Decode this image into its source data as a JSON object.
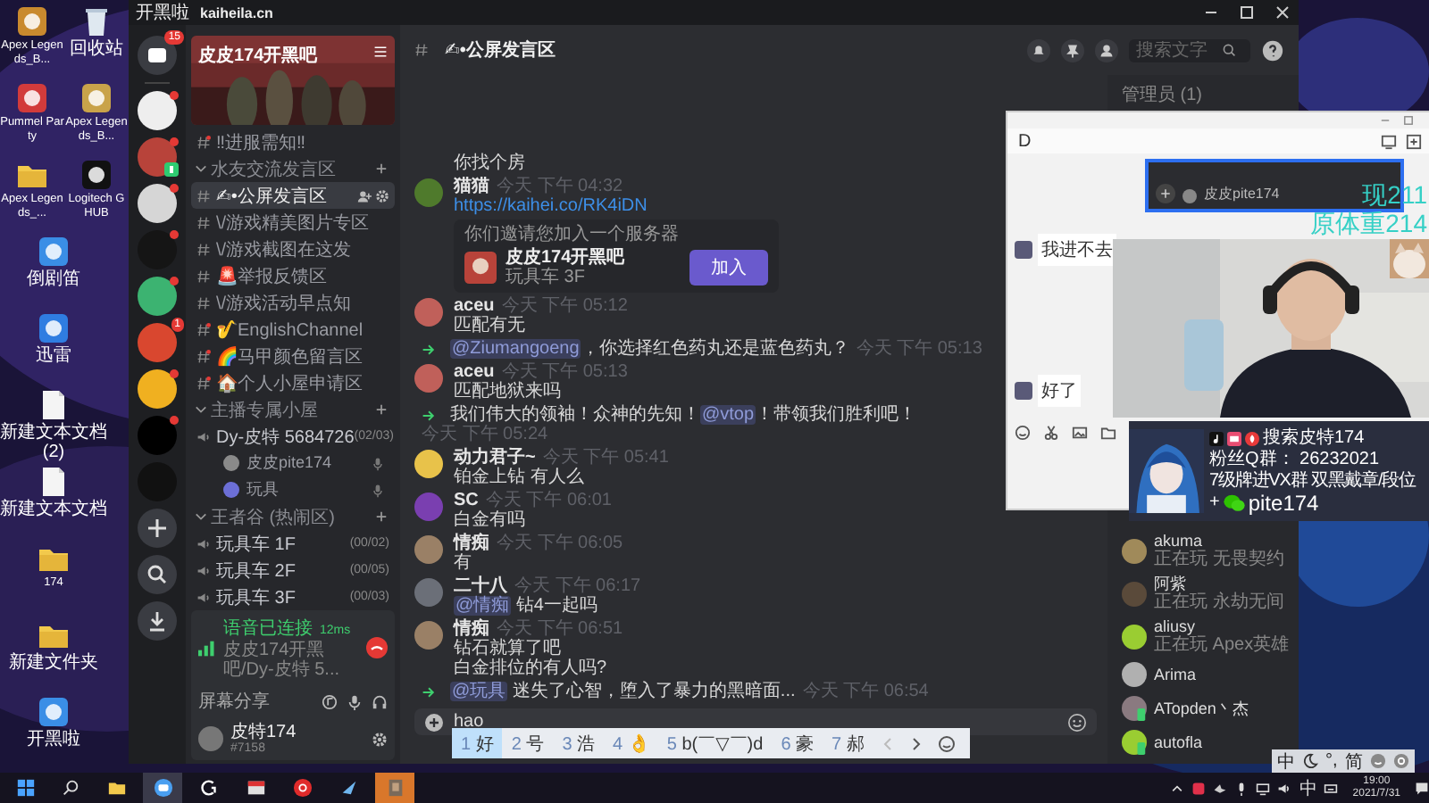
{
  "desktop_icons": [
    {
      "kind": "app",
      "color": "#c98a2e",
      "label": "Apex Legends_B..."
    },
    {
      "kind": "bin",
      "label": "回收站"
    },
    {
      "kind": "app",
      "color": "#d23b3b",
      "label": "Pummel Party"
    },
    {
      "kind": "app",
      "color": "#c9a34a",
      "label": "Apex Legends_B..."
    },
    {
      "kind": "folder",
      "label": "Apex Legends_..."
    },
    {
      "kind": "app",
      "color": "#111111",
      "label": "Logitech G HUB"
    },
    {
      "kind": "app",
      "color": "#3a8ee6",
      "label": "倒剧笛"
    },
    {
      "kind": "app",
      "color": "#2f7de1",
      "label": "迅雷"
    },
    {
      "kind": "file",
      "label": "新建文本文档 (2)"
    },
    {
      "kind": "file",
      "label": "新建文本文档"
    },
    {
      "kind": "folder",
      "label": "174"
    },
    {
      "kind": "folder",
      "label": "新建文件夹"
    },
    {
      "kind": "app",
      "color": "#3a8ee6",
      "label": "开黑啦"
    }
  ],
  "app": {
    "title": "开黑啦",
    "url": "kaiheila.cn",
    "home_badge": "15",
    "servers": [
      {
        "color": "#eeeeee",
        "unread": true,
        "in_voice": false
      },
      {
        "color": "#b8433a",
        "unread": true,
        "in_voice": true
      },
      {
        "color": "#d6d6d6",
        "unread": true,
        "in_voice": false
      },
      {
        "color": "#151515",
        "unread": true,
        "in_voice": false
      },
      {
        "color": "#3cb371",
        "unread": true,
        "in_voice": false
      },
      {
        "color": "#d9472f",
        "unread": false,
        "badge": "1",
        "in_voice": false
      },
      {
        "color": "#f0b020",
        "unread": true,
        "in_voice": false
      },
      {
        "color": "#000000",
        "unread": true,
        "in_voice": false
      },
      {
        "color": "#111111",
        "unread": false,
        "in_voice": false
      }
    ],
    "server_name": "皮皮174开黑吧",
    "channels": [
      {
        "kind": "text",
        "name": "‼进服需知‼",
        "unread": true,
        "selected": false
      },
      {
        "kind": "category",
        "name": "水友交流发言区",
        "children": [
          {
            "kind": "text",
            "name": "✍•公屏发言区",
            "unread": false,
            "selected": true
          },
          {
            "kind": "text",
            "name": "\\/游戏精美图片专区",
            "unread": false,
            "selected": false
          },
          {
            "kind": "text",
            "name": "\\/游戏截图在这发",
            "unread": false,
            "selected": false
          },
          {
            "kind": "text",
            "name": "🚨举报反馈区",
            "unread": false,
            "selected": false
          },
          {
            "kind": "text",
            "name": "\\/游戏活动早点知",
            "unread": false,
            "selected": false
          },
          {
            "kind": "text",
            "name": "🎷EnglishChannel",
            "unread": true,
            "selected": false
          },
          {
            "kind": "text",
            "name": "🌈马甲颜色留言区",
            "unread": true,
            "selected": false
          },
          {
            "kind": "text",
            "name": "🏠个人小屋申请区",
            "unread": true,
            "selected": false
          }
        ]
      },
      {
        "kind": "category",
        "name": "主播专属小屋",
        "children": [
          {
            "kind": "voice",
            "name": "Dy-皮特 5684726",
            "count": "(02/03)",
            "children": [
              {
                "name": "皮皮pite174",
                "color": "#8a8a8a"
              },
              {
                "name": "玩具",
                "color": "#6c6fd6"
              }
            ]
          }
        ]
      },
      {
        "kind": "category",
        "name": "王者谷 (热闹区)",
        "children": [
          {
            "kind": "voice",
            "name": "玩具车 1F",
            "count": "(00/02)"
          },
          {
            "kind": "voice",
            "name": "玩具车 2F",
            "count": "(00/05)"
          },
          {
            "kind": "voice",
            "name": "玩具车 3F",
            "count": "(00/03)"
          }
        ]
      }
    ],
    "voice_status": {
      "state": "语音已连接",
      "ping": "12ms",
      "channel": "皮皮174开黑吧/Dy-皮特 5..."
    },
    "share_label": "屏幕分享",
    "user": {
      "name": "皮特174",
      "tag": "#7158"
    },
    "chat": {
      "channel": "✍•公屏发言区",
      "search_placeholder": "搜索文字",
      "messages": [
        {
          "kind": "continuation",
          "lines": [
            {
              "text": "你找个房"
            }
          ]
        },
        {
          "kind": "message",
          "author": "猫猫",
          "time": "今天 下午 04:32",
          "color": "#4f7a2c",
          "link": "https://kaihei.co/RK4iDN",
          "invite": {
            "caption": "你们邀请您加入一个服务器",
            "name": "皮皮174开黑吧",
            "channel": "玩具车 3F",
            "button": "加入"
          }
        },
        {
          "kind": "message",
          "author": "aceu",
          "time": "今天 下午 05:12",
          "color": "#c0605a",
          "lines": [
            {
              "text": "匹配有无"
            }
          ]
        },
        {
          "kind": "system",
          "time": "今天 下午 05:13",
          "lines": [
            {
              "mention": "@Ziumangoeng",
              "text": "，你选择红色药丸还是蓝色药丸？"
            }
          ]
        },
        {
          "kind": "message",
          "author": "aceu",
          "time": "今天 下午 05:13",
          "color": "#c0605a",
          "lines": [
            {
              "text": "匹配地狱来吗"
            }
          ]
        },
        {
          "kind": "system",
          "time": "今天 下午 05:24",
          "lines": [
            {
              "before": "我们伟大的领袖！众神的先知！",
              "mention": "@vtop",
              "text": "！带领我们胜利吧！"
            }
          ]
        },
        {
          "kind": "message",
          "author": "动力君子~",
          "time": "今天 下午 05:41",
          "color": "#e8c24a",
          "lines": [
            {
              "text": "铂金上钻 有人么"
            }
          ]
        },
        {
          "kind": "message",
          "author": "SC",
          "time": "今天 下午 06:01",
          "color": "#7a3fb0",
          "lines": [
            {
              "text": "白金有吗"
            }
          ]
        },
        {
          "kind": "message",
          "author": "情痴",
          "time": "今天 下午 06:05",
          "color": "#9a8066",
          "lines": [
            {
              "text": "有"
            }
          ]
        },
        {
          "kind": "message",
          "author": "二十八",
          "time": "今天 下午 06:17",
          "color": "#6b6f78",
          "lines": [
            {
              "mention": "@情痴",
              "text": " 钻4一起吗"
            }
          ]
        },
        {
          "kind": "message",
          "author": "情痴",
          "time": "今天 下午 06:51",
          "color": "#9a8066",
          "lines": [
            {
              "text": "钻石就算了吧"
            },
            {
              "text": "白金排位的有人吗?"
            }
          ]
        },
        {
          "kind": "system",
          "time": "今天 下午 06:54",
          "lines": [
            {
              "mention": "@玩具",
              "text": " 迷失了心智，堕入了暴力的黑暗面..."
            }
          ]
        }
      ],
      "input": "hao"
    },
    "members_header": "管理员 (1)",
    "members": [
      {
        "name": "akuma",
        "activity": "正在玩 无畏契约",
        "color": "#a08a5a",
        "mobile": false
      },
      {
        "name": "阿紫",
        "activity": "正在玩 永劫无间",
        "color": "#5a4a3a",
        "mobile": false
      },
      {
        "name": "aliusy",
        "activity": "正在玩 Apex英雄",
        "color": "#9acd32",
        "mobile": false
      },
      {
        "name": "Arima",
        "color": "#b0b0b0",
        "mobile": false
      },
      {
        "name": "ATopden丶杰",
        "color": "#8a7a80",
        "mobile": true
      },
      {
        "name": "autofla",
        "color": "#9acd32",
        "mobile": true
      }
    ]
  },
  "ime": {
    "candidates": [
      {
        "num": "1",
        "text": "好",
        "selected": true
      },
      {
        "num": "2",
        "text": "号",
        "selected": false
      },
      {
        "num": "3",
        "text": "浩",
        "selected": false
      },
      {
        "num": "4",
        "text": "👌",
        "selected": false
      },
      {
        "num": "5",
        "text": "b(￣▽￣)d",
        "selected": false
      },
      {
        "num": "6",
        "text": "豪",
        "selected": false
      },
      {
        "num": "7",
        "text": "郝",
        "selected": false
      }
    ],
    "status": [
      {
        "kind": "text",
        "text": "中"
      },
      {
        "kind": "moon"
      },
      {
        "kind": "text",
        "text": "°,"
      },
      {
        "kind": "text",
        "text": "简"
      },
      {
        "kind": "smile"
      },
      {
        "kind": "gear"
      }
    ]
  },
  "chat_window": {
    "title": "D",
    "shared_name": "皮皮pite174",
    "messages": [
      "我进不去",
      "好了"
    ]
  },
  "stream_overlay": {
    "weight_now": "现211",
    "weight_orig": "原体重214",
    "lines": [
      "搜索皮特174",
      "粉丝Q群： 26232021",
      "7级牌进VX群 双黑戴章/段位"
    ],
    "wechat_prefix": "+",
    "wechat": "pite174"
  },
  "taskbar": {
    "apps": [
      {
        "kind": "files",
        "active": false,
        "flashing": false
      },
      {
        "kind": "chat",
        "active": true,
        "flashing": false
      },
      {
        "kind": "logi",
        "active": false,
        "flashing": false
      },
      {
        "kind": "red",
        "active": false,
        "flashing": false
      },
      {
        "kind": "music",
        "active": false,
        "flashing": false
      },
      {
        "kind": "steam",
        "active": false,
        "flashing": false
      },
      {
        "kind": "game",
        "active": false,
        "flashing": true
      }
    ],
    "tray_ime": "中",
    "time": "19:00",
    "date": "2021/7/31"
  }
}
